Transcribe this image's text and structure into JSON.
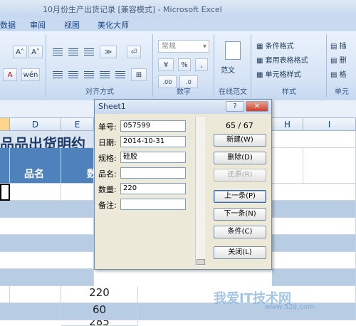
{
  "window": {
    "title": "10月份生产出货记录 [兼容模式] - Microsoft Excel"
  },
  "ribbon": {
    "tabs": [
      "数据",
      "审阅",
      "视图",
      "美化大师"
    ],
    "number_format": "常规",
    "groups": {
      "alignment": "对齐方式",
      "number": "数字",
      "online": "在线范文",
      "styles": "样式",
      "cells": "单元"
    },
    "online_btn": "范文",
    "styles_items": [
      "条件格式",
      "套用表格格式",
      "单元格样式"
    ],
    "cells_items": [
      "插",
      "删",
      "格"
    ],
    "buttons": {
      "percent": "%",
      "comma": ",",
      "font_grow": "A˄",
      "font_shrink": "A˅"
    }
  },
  "sheet": {
    "columns": [
      "D",
      "E",
      "H",
      "I"
    ],
    "title_fragment": "品品出货明约",
    "header_label": "品名",
    "header_partial": "数",
    "values": [
      "220",
      "60",
      "285"
    ]
  },
  "dialog": {
    "title": "Sheet1",
    "record_counter": "65 / 67",
    "fields": [
      {
        "label": "单号:",
        "value": "057599"
      },
      {
        "label": "日期:",
        "value": "2014-10-31"
      },
      {
        "label": "规格:",
        "value": "硅胶"
      },
      {
        "label": "品名:",
        "value": ""
      },
      {
        "label": "数量:",
        "value": "220"
      },
      {
        "label": "备注:",
        "value": ""
      }
    ],
    "buttons": {
      "new": "新建(W)",
      "delete": "删除(D)",
      "restore": "还原(R)",
      "prev": "上一条(P)",
      "next": "下一条(N)",
      "criteria": "条件(C)",
      "close": "关闭(L)"
    },
    "help": "?"
  },
  "watermark": {
    "text": "我爱IT技术网",
    "url": "www.52ij.com"
  }
}
